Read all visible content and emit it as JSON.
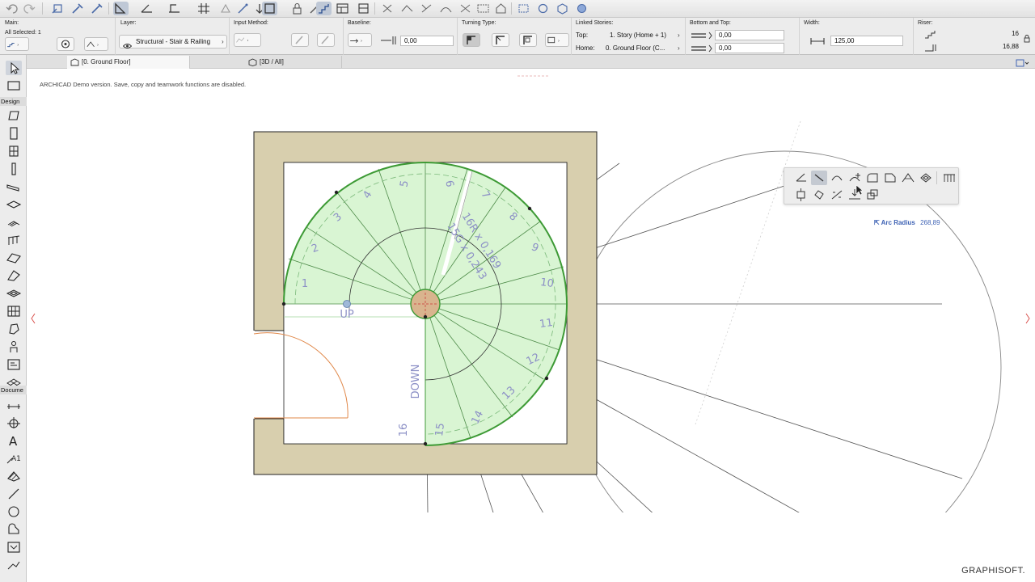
{
  "infobox": {
    "main": {
      "label": "Main:",
      "selection": "All Selected: 1"
    },
    "layer": {
      "label": "Layer:",
      "value": "Structural - Stair & Railing"
    },
    "input_method": {
      "label": "Input Method:"
    },
    "baseline": {
      "label": "Baseline:",
      "value": "0,00"
    },
    "turning_type": {
      "label": "Turning Type:"
    },
    "linked_stories": {
      "label": "Linked Stories:",
      "top_label": "Top:",
      "top_value": "1. Story (Home + 1)",
      "home_label": "Home:",
      "home_value": "0. Ground Floor (C..."
    },
    "bottom_top": {
      "label": "Bottom and Top:",
      "top_value": "0,00",
      "bottom_value": "0,00"
    },
    "width": {
      "label": "Width:",
      "value": "125,00"
    },
    "riser": {
      "label": "Riser:",
      "count": "16",
      "height": "16,88"
    }
  },
  "tabs": [
    {
      "label": "[0. Ground Floor]",
      "active": true
    },
    {
      "label": "[3D / All]",
      "active": false
    }
  ],
  "toolbox": {
    "design_header": "Design",
    "document_header": "Docume"
  },
  "canvas": {
    "demo_notice": "ARCHICAD Demo version. Save, copy and teamwork functions are disabled."
  },
  "stair": {
    "up_label": "UP",
    "down_label": "DOWN",
    "rule_line1": "16R x 0,169",
    "rule_line2": "15G x 0,243",
    "tread_numbers": [
      "1",
      "2",
      "3",
      "4",
      "5",
      "6",
      "7",
      "8",
      "9",
      "10",
      "11",
      "12",
      "13",
      "14",
      "15",
      "16"
    ]
  },
  "tracker": {
    "label": "Arc Radius",
    "value": "268,89"
  },
  "brand": "GRAPHISOFT.",
  "colors": {
    "wall": "#d8cfae",
    "stair_fill": "#d9f5d3",
    "stair_outline": "#3d9a35",
    "number_text": "#8c90c6",
    "tracker_text": "#3f63b5",
    "door_arc": "#e0884a"
  }
}
